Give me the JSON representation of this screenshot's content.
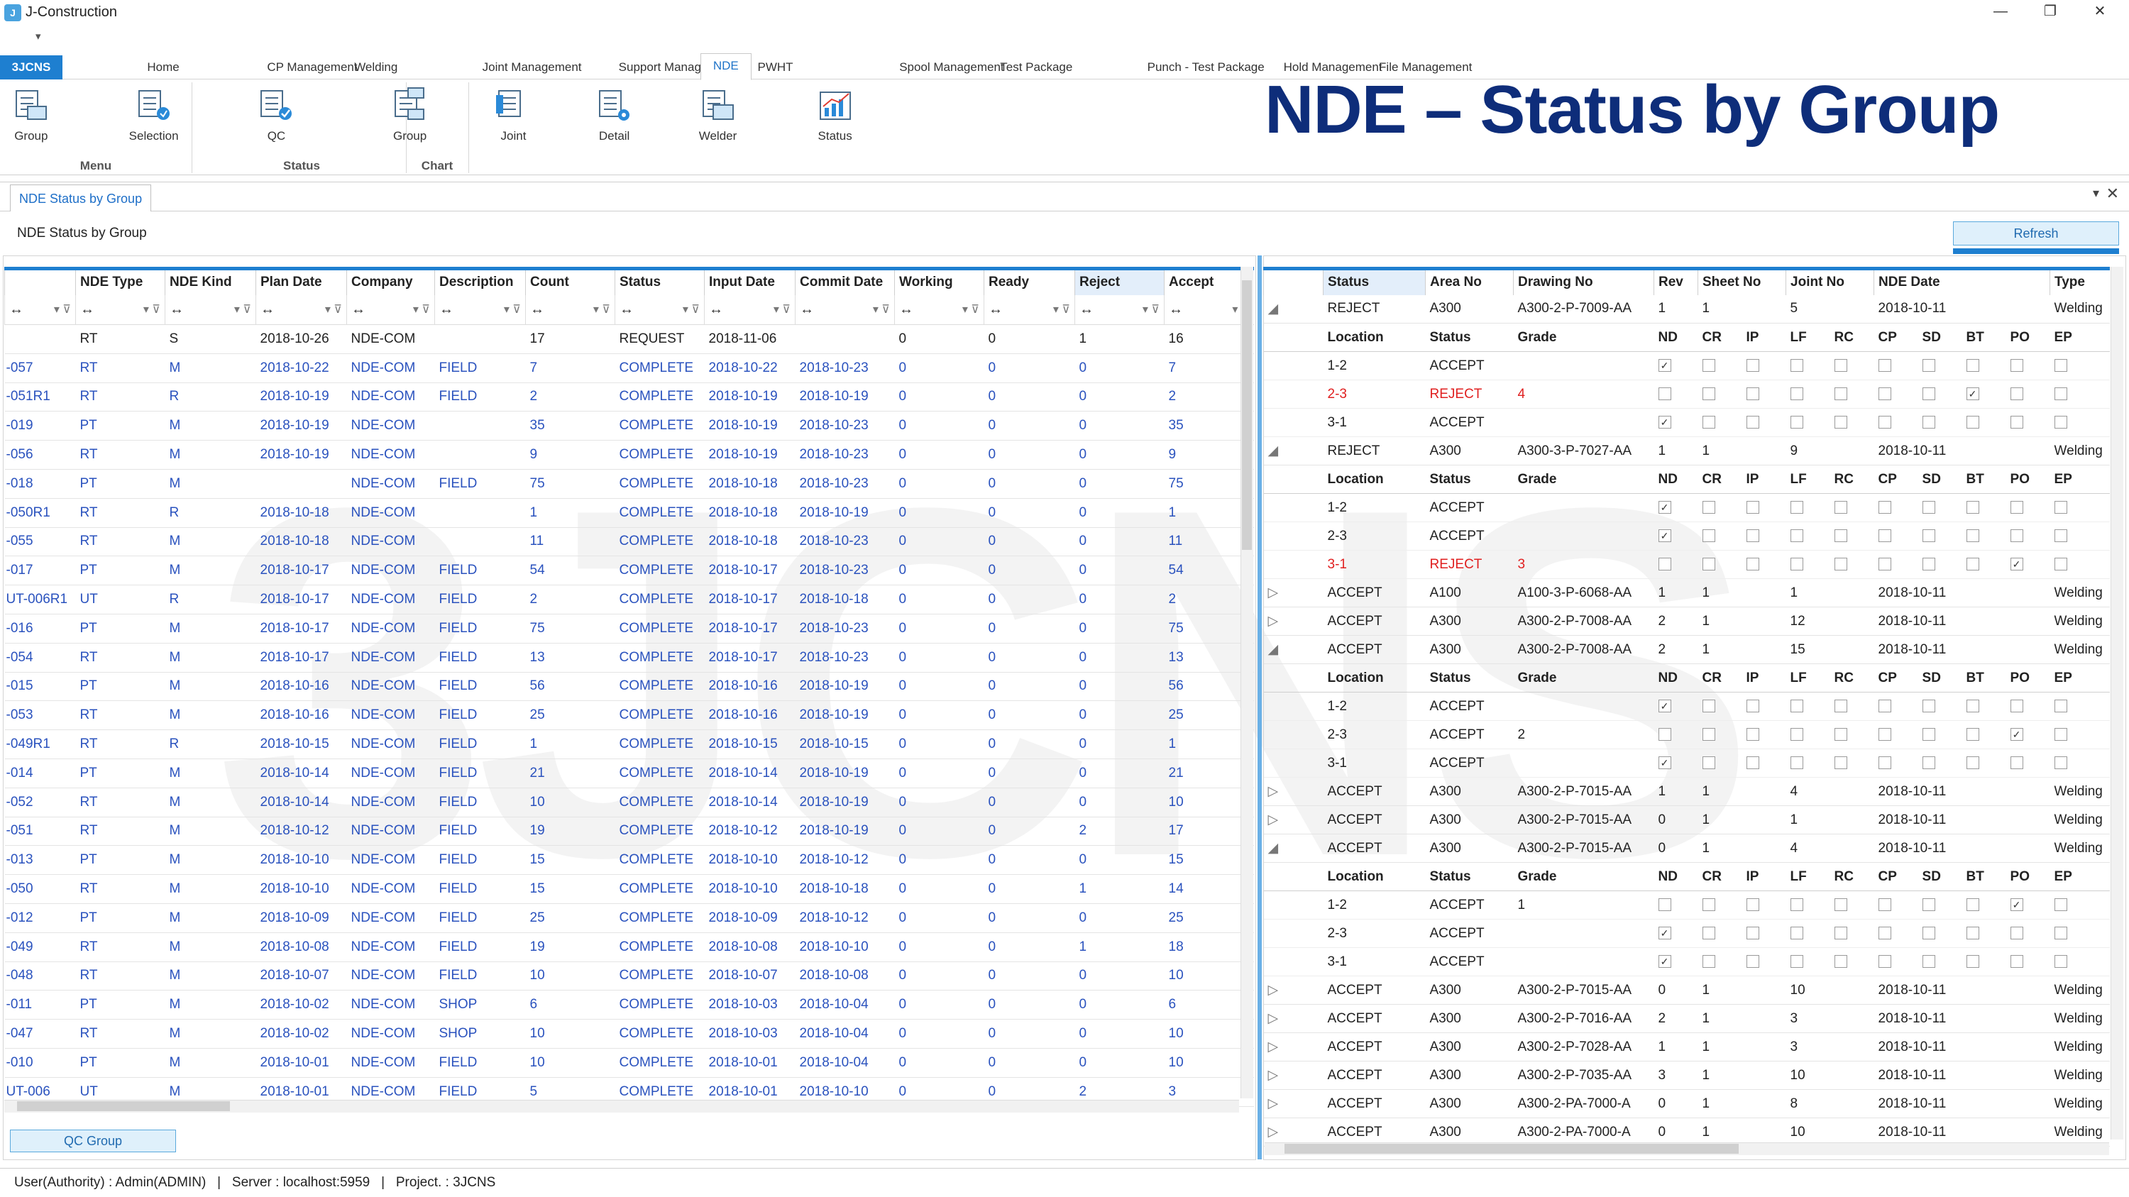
{
  "app": {
    "title": "J-Construction",
    "logo": "J",
    "quick_access": "▾",
    "brand": "3JCNS",
    "heading": "NDE – Status by Group",
    "watermark": "3JCNS"
  },
  "menu": {
    "tabs": [
      "Home",
      "CP Management",
      "Welding",
      "Joint Management",
      "Support Management",
      "NDE",
      "PWHT",
      "Spool Management",
      "Test Package",
      "Punch - Test Package",
      "Hold Management",
      "File Management"
    ],
    "active": "NDE"
  },
  "ribbon": {
    "buttons": [
      {
        "label": "Group",
        "icon": "group-icon"
      },
      {
        "label": "Selection",
        "icon": "selection-icon"
      },
      {
        "label": "QC",
        "icon": "qc-icon"
      },
      {
        "label": "Group",
        "icon": "status-group-icon"
      },
      {
        "label": "Joint",
        "icon": "joint-icon"
      },
      {
        "label": "Detail",
        "icon": "detail-icon"
      },
      {
        "label": "Welder",
        "icon": "welder-icon"
      },
      {
        "label": "Status",
        "icon": "chart-icon"
      }
    ],
    "groups": [
      "Menu",
      "Status",
      "Chart"
    ]
  },
  "document": {
    "tab": "NDE Status by Group",
    "page_title": "NDE Status by Group",
    "refresh": "Refresh",
    "qc_group": "QC Group"
  },
  "left_grid": {
    "columns": [
      "",
      "NDE Type",
      "NDE Kind",
      "Plan Date",
      "Company",
      "Description",
      "Count",
      "Status",
      "Input Date",
      "Commit Date",
      "Working",
      "Ready",
      "Reject",
      "Accept"
    ],
    "rows": [
      [
        "",
        "RT",
        "S",
        "2018-10-26",
        "NDE-COM",
        "",
        "17",
        "REQUEST",
        "2018-11-06",
        "",
        "0",
        "0",
        "1",
        "16"
      ],
      [
        "-057",
        "RT",
        "M",
        "2018-10-22",
        "NDE-COM",
        "FIELD",
        "7",
        "COMPLETE",
        "2018-10-22",
        "2018-10-23",
        "0",
        "0",
        "0",
        "7"
      ],
      [
        "-051R1",
        "RT",
        "R",
        "2018-10-19",
        "NDE-COM",
        "FIELD",
        "2",
        "COMPLETE",
        "2018-10-19",
        "2018-10-19",
        "0",
        "0",
        "0",
        "2"
      ],
      [
        "-019",
        "PT",
        "M",
        "2018-10-19",
        "NDE-COM",
        "",
        "35",
        "COMPLETE",
        "2018-10-19",
        "2018-10-23",
        "0",
        "0",
        "0",
        "35"
      ],
      [
        "-056",
        "RT",
        "M",
        "2018-10-19",
        "NDE-COM",
        "",
        "9",
        "COMPLETE",
        "2018-10-19",
        "2018-10-23",
        "0",
        "0",
        "0",
        "9"
      ],
      [
        "-018",
        "PT",
        "M",
        "",
        "NDE-COM",
        "FIELD",
        "75",
        "COMPLETE",
        "2018-10-18",
        "2018-10-23",
        "0",
        "0",
        "0",
        "75"
      ],
      [
        "-050R1",
        "RT",
        "R",
        "2018-10-18",
        "NDE-COM",
        "",
        "1",
        "COMPLETE",
        "2018-10-18",
        "2018-10-19",
        "0",
        "0",
        "0",
        "1"
      ],
      [
        "-055",
        "RT",
        "M",
        "2018-10-18",
        "NDE-COM",
        "",
        "11",
        "COMPLETE",
        "2018-10-18",
        "2018-10-23",
        "0",
        "0",
        "0",
        "11"
      ],
      [
        "-017",
        "PT",
        "M",
        "2018-10-17",
        "NDE-COM",
        "FIELD",
        "54",
        "COMPLETE",
        "2018-10-17",
        "2018-10-23",
        "0",
        "0",
        "0",
        "54"
      ],
      [
        "UT-006R1",
        "UT",
        "R",
        "2018-10-17",
        "NDE-COM",
        "FIELD",
        "2",
        "COMPLETE",
        "2018-10-17",
        "2018-10-18",
        "0",
        "0",
        "0",
        "2"
      ],
      [
        "-016",
        "PT",
        "M",
        "2018-10-17",
        "NDE-COM",
        "FIELD",
        "75",
        "COMPLETE",
        "2018-10-17",
        "2018-10-23",
        "0",
        "0",
        "0",
        "75"
      ],
      [
        "-054",
        "RT",
        "M",
        "2018-10-17",
        "NDE-COM",
        "FIELD",
        "13",
        "COMPLETE",
        "2018-10-17",
        "2018-10-23",
        "0",
        "0",
        "0",
        "13"
      ],
      [
        "-015",
        "PT",
        "M",
        "2018-10-16",
        "NDE-COM",
        "FIELD",
        "56",
        "COMPLETE",
        "2018-10-16",
        "2018-10-19",
        "0",
        "0",
        "0",
        "56"
      ],
      [
        "-053",
        "RT",
        "M",
        "2018-10-16",
        "NDE-COM",
        "FIELD",
        "25",
        "COMPLETE",
        "2018-10-16",
        "2018-10-19",
        "0",
        "0",
        "0",
        "25"
      ],
      [
        "-049R1",
        "RT",
        "R",
        "2018-10-15",
        "NDE-COM",
        "FIELD",
        "1",
        "COMPLETE",
        "2018-10-15",
        "2018-10-15",
        "0",
        "0",
        "0",
        "1"
      ],
      [
        "-014",
        "PT",
        "M",
        "2018-10-14",
        "NDE-COM",
        "FIELD",
        "21",
        "COMPLETE",
        "2018-10-14",
        "2018-10-19",
        "0",
        "0",
        "0",
        "21"
      ],
      [
        "-052",
        "RT",
        "M",
        "2018-10-14",
        "NDE-COM",
        "FIELD",
        "10",
        "COMPLETE",
        "2018-10-14",
        "2018-10-19",
        "0",
        "0",
        "0",
        "10"
      ],
      [
        "-051",
        "RT",
        "M",
        "2018-10-12",
        "NDE-COM",
        "FIELD",
        "19",
        "COMPLETE",
        "2018-10-12",
        "2018-10-19",
        "0",
        "0",
        "2",
        "17"
      ],
      [
        "-013",
        "PT",
        "M",
        "2018-10-10",
        "NDE-COM",
        "FIELD",
        "15",
        "COMPLETE",
        "2018-10-10",
        "2018-10-12",
        "0",
        "0",
        "0",
        "15"
      ],
      [
        "-050",
        "RT",
        "M",
        "2018-10-10",
        "NDE-COM",
        "FIELD",
        "15",
        "COMPLETE",
        "2018-10-10",
        "2018-10-18",
        "0",
        "0",
        "1",
        "14"
      ],
      [
        "-012",
        "PT",
        "M",
        "2018-10-09",
        "NDE-COM",
        "FIELD",
        "25",
        "COMPLETE",
        "2018-10-09",
        "2018-10-12",
        "0",
        "0",
        "0",
        "25"
      ],
      [
        "-049",
        "RT",
        "M",
        "2018-10-08",
        "NDE-COM",
        "FIELD",
        "19",
        "COMPLETE",
        "2018-10-08",
        "2018-10-10",
        "0",
        "0",
        "1",
        "18"
      ],
      [
        "-048",
        "RT",
        "M",
        "2018-10-07",
        "NDE-COM",
        "FIELD",
        "10",
        "COMPLETE",
        "2018-10-07",
        "2018-10-08",
        "0",
        "0",
        "0",
        "10"
      ],
      [
        "-011",
        "PT",
        "M",
        "2018-10-02",
        "NDE-COM",
        "SHOP",
        "6",
        "COMPLETE",
        "2018-10-03",
        "2018-10-04",
        "0",
        "0",
        "0",
        "6"
      ],
      [
        "-047",
        "RT",
        "M",
        "2018-10-02",
        "NDE-COM",
        "SHOP",
        "10",
        "COMPLETE",
        "2018-10-03",
        "2018-10-04",
        "0",
        "0",
        "0",
        "10"
      ],
      [
        "-010",
        "PT",
        "M",
        "2018-10-01",
        "NDE-COM",
        "FIELD",
        "10",
        "COMPLETE",
        "2018-10-01",
        "2018-10-04",
        "0",
        "0",
        "0",
        "10"
      ],
      [
        "UT-006",
        "UT",
        "M",
        "2018-10-01",
        "NDE-COM",
        "FIELD",
        "5",
        "COMPLETE",
        "2018-10-01",
        "2018-10-10",
        "0",
        "0",
        "2",
        "3"
      ]
    ]
  },
  "right_grid": {
    "columns": [
      "",
      "Status",
      "Area No",
      "Drawing No",
      "Rev",
      "Sheet No",
      "Joint No",
      "NDE Date",
      "Type"
    ],
    "detail_columns": [
      "Location",
      "Status",
      "Grade",
      "ND",
      "CR",
      "IP",
      "LF",
      "RC",
      "CP",
      "SD",
      "BT",
      "PO",
      "EP"
    ],
    "groups": [
      {
        "expanded": true,
        "row": [
          "REJECT",
          "A300",
          "A300-2-P-7009-AA",
          "1",
          "1",
          "5",
          "2018-10-11",
          "Welding"
        ],
        "details": [
          [
            "1-2",
            "ACCEPT",
            "",
            [
              1,
              0,
              0,
              0,
              0,
              0,
              0,
              0,
              0,
              0
            ]
          ],
          [
            "2-3",
            "REJECT",
            "4",
            [
              0,
              0,
              0,
              0,
              0,
              0,
              0,
              1,
              0,
              0
            ]
          ],
          [
            "3-1",
            "ACCEPT",
            "",
            [
              1,
              0,
              0,
              0,
              0,
              0,
              0,
              0,
              0,
              0
            ]
          ]
        ]
      },
      {
        "expanded": true,
        "row": [
          "REJECT",
          "A300",
          "A300-3-P-7027-AA",
          "1",
          "1",
          "9",
          "2018-10-11",
          "Welding"
        ],
        "details": [
          [
            "1-2",
            "ACCEPT",
            "",
            [
              1,
              0,
              0,
              0,
              0,
              0,
              0,
              0,
              0,
              0
            ]
          ],
          [
            "2-3",
            "ACCEPT",
            "",
            [
              1,
              0,
              0,
              0,
              0,
              0,
              0,
              0,
              0,
              0
            ]
          ],
          [
            "3-1",
            "REJECT",
            "3",
            [
              0,
              0,
              0,
              0,
              0,
              0,
              0,
              0,
              1,
              0
            ]
          ]
        ]
      },
      {
        "expanded": false,
        "row": [
          "ACCEPT",
          "A100",
          "A100-3-P-6068-AA",
          "1",
          "1",
          "1",
          "2018-10-11",
          "Welding"
        ]
      },
      {
        "expanded": false,
        "row": [
          "ACCEPT",
          "A300",
          "A300-2-P-7008-AA",
          "2",
          "1",
          "12",
          "2018-10-11",
          "Welding"
        ]
      },
      {
        "expanded": true,
        "row": [
          "ACCEPT",
          "A300",
          "A300-2-P-7008-AA",
          "2",
          "1",
          "15",
          "2018-10-11",
          "Welding"
        ],
        "details": [
          [
            "1-2",
            "ACCEPT",
            "",
            [
              1,
              0,
              0,
              0,
              0,
              0,
              0,
              0,
              0,
              0
            ]
          ],
          [
            "2-3",
            "ACCEPT",
            "2",
            [
              0,
              0,
              0,
              0,
              0,
              0,
              0,
              0,
              1,
              0
            ]
          ],
          [
            "3-1",
            "ACCEPT",
            "",
            [
              1,
              0,
              0,
              0,
              0,
              0,
              0,
              0,
              0,
              0
            ]
          ]
        ]
      },
      {
        "expanded": false,
        "row": [
          "ACCEPT",
          "A300",
          "A300-2-P-7015-AA",
          "1",
          "1",
          "4",
          "2018-10-11",
          "Welding"
        ]
      },
      {
        "expanded": false,
        "row": [
          "ACCEPT",
          "A300",
          "A300-2-P-7015-AA",
          "0",
          "1",
          "1",
          "2018-10-11",
          "Welding"
        ]
      },
      {
        "expanded": true,
        "row": [
          "ACCEPT",
          "A300",
          "A300-2-P-7015-AA",
          "0",
          "1",
          "4",
          "2018-10-11",
          "Welding"
        ],
        "details": [
          [
            "1-2",
            "ACCEPT",
            "1",
            [
              0,
              0,
              0,
              0,
              0,
              0,
              0,
              0,
              1,
              0
            ]
          ],
          [
            "2-3",
            "ACCEPT",
            "",
            [
              1,
              0,
              0,
              0,
              0,
              0,
              0,
              0,
              0,
              0
            ]
          ],
          [
            "3-1",
            "ACCEPT",
            "",
            [
              1,
              0,
              0,
              0,
              0,
              0,
              0,
              0,
              0,
              0
            ]
          ]
        ]
      },
      {
        "expanded": false,
        "row": [
          "ACCEPT",
          "A300",
          "A300-2-P-7015-AA",
          "0",
          "1",
          "10",
          "2018-10-11",
          "Welding"
        ]
      },
      {
        "expanded": false,
        "row": [
          "ACCEPT",
          "A300",
          "A300-2-P-7016-AA",
          "2",
          "1",
          "3",
          "2018-10-11",
          "Welding"
        ]
      },
      {
        "expanded": false,
        "row": [
          "ACCEPT",
          "A300",
          "A300-2-P-7028-AA",
          "1",
          "1",
          "3",
          "2018-10-11",
          "Welding"
        ]
      },
      {
        "expanded": false,
        "row": [
          "ACCEPT",
          "A300",
          "A300-2-P-7035-AA",
          "3",
          "1",
          "10",
          "2018-10-11",
          "Welding"
        ]
      },
      {
        "expanded": false,
        "row": [
          "ACCEPT",
          "A300",
          "A300-2-PA-7000-A",
          "0",
          "1",
          "8",
          "2018-10-11",
          "Welding"
        ]
      },
      {
        "expanded": false,
        "row": [
          "ACCEPT",
          "A300",
          "A300-2-PA-7000-A",
          "0",
          "1",
          "10",
          "2018-10-11",
          "Welding"
        ]
      }
    ]
  },
  "statusbar": {
    "user": "User(Authority) : Admin(ADMIN)",
    "server": "Server : localhost:5959",
    "project": "Project. : 3JCNS"
  },
  "colors": {
    "accent": "#1e7fd0",
    "link": "#2a52be",
    "reject": "#e02020",
    "heading": "#0e2d7a"
  }
}
